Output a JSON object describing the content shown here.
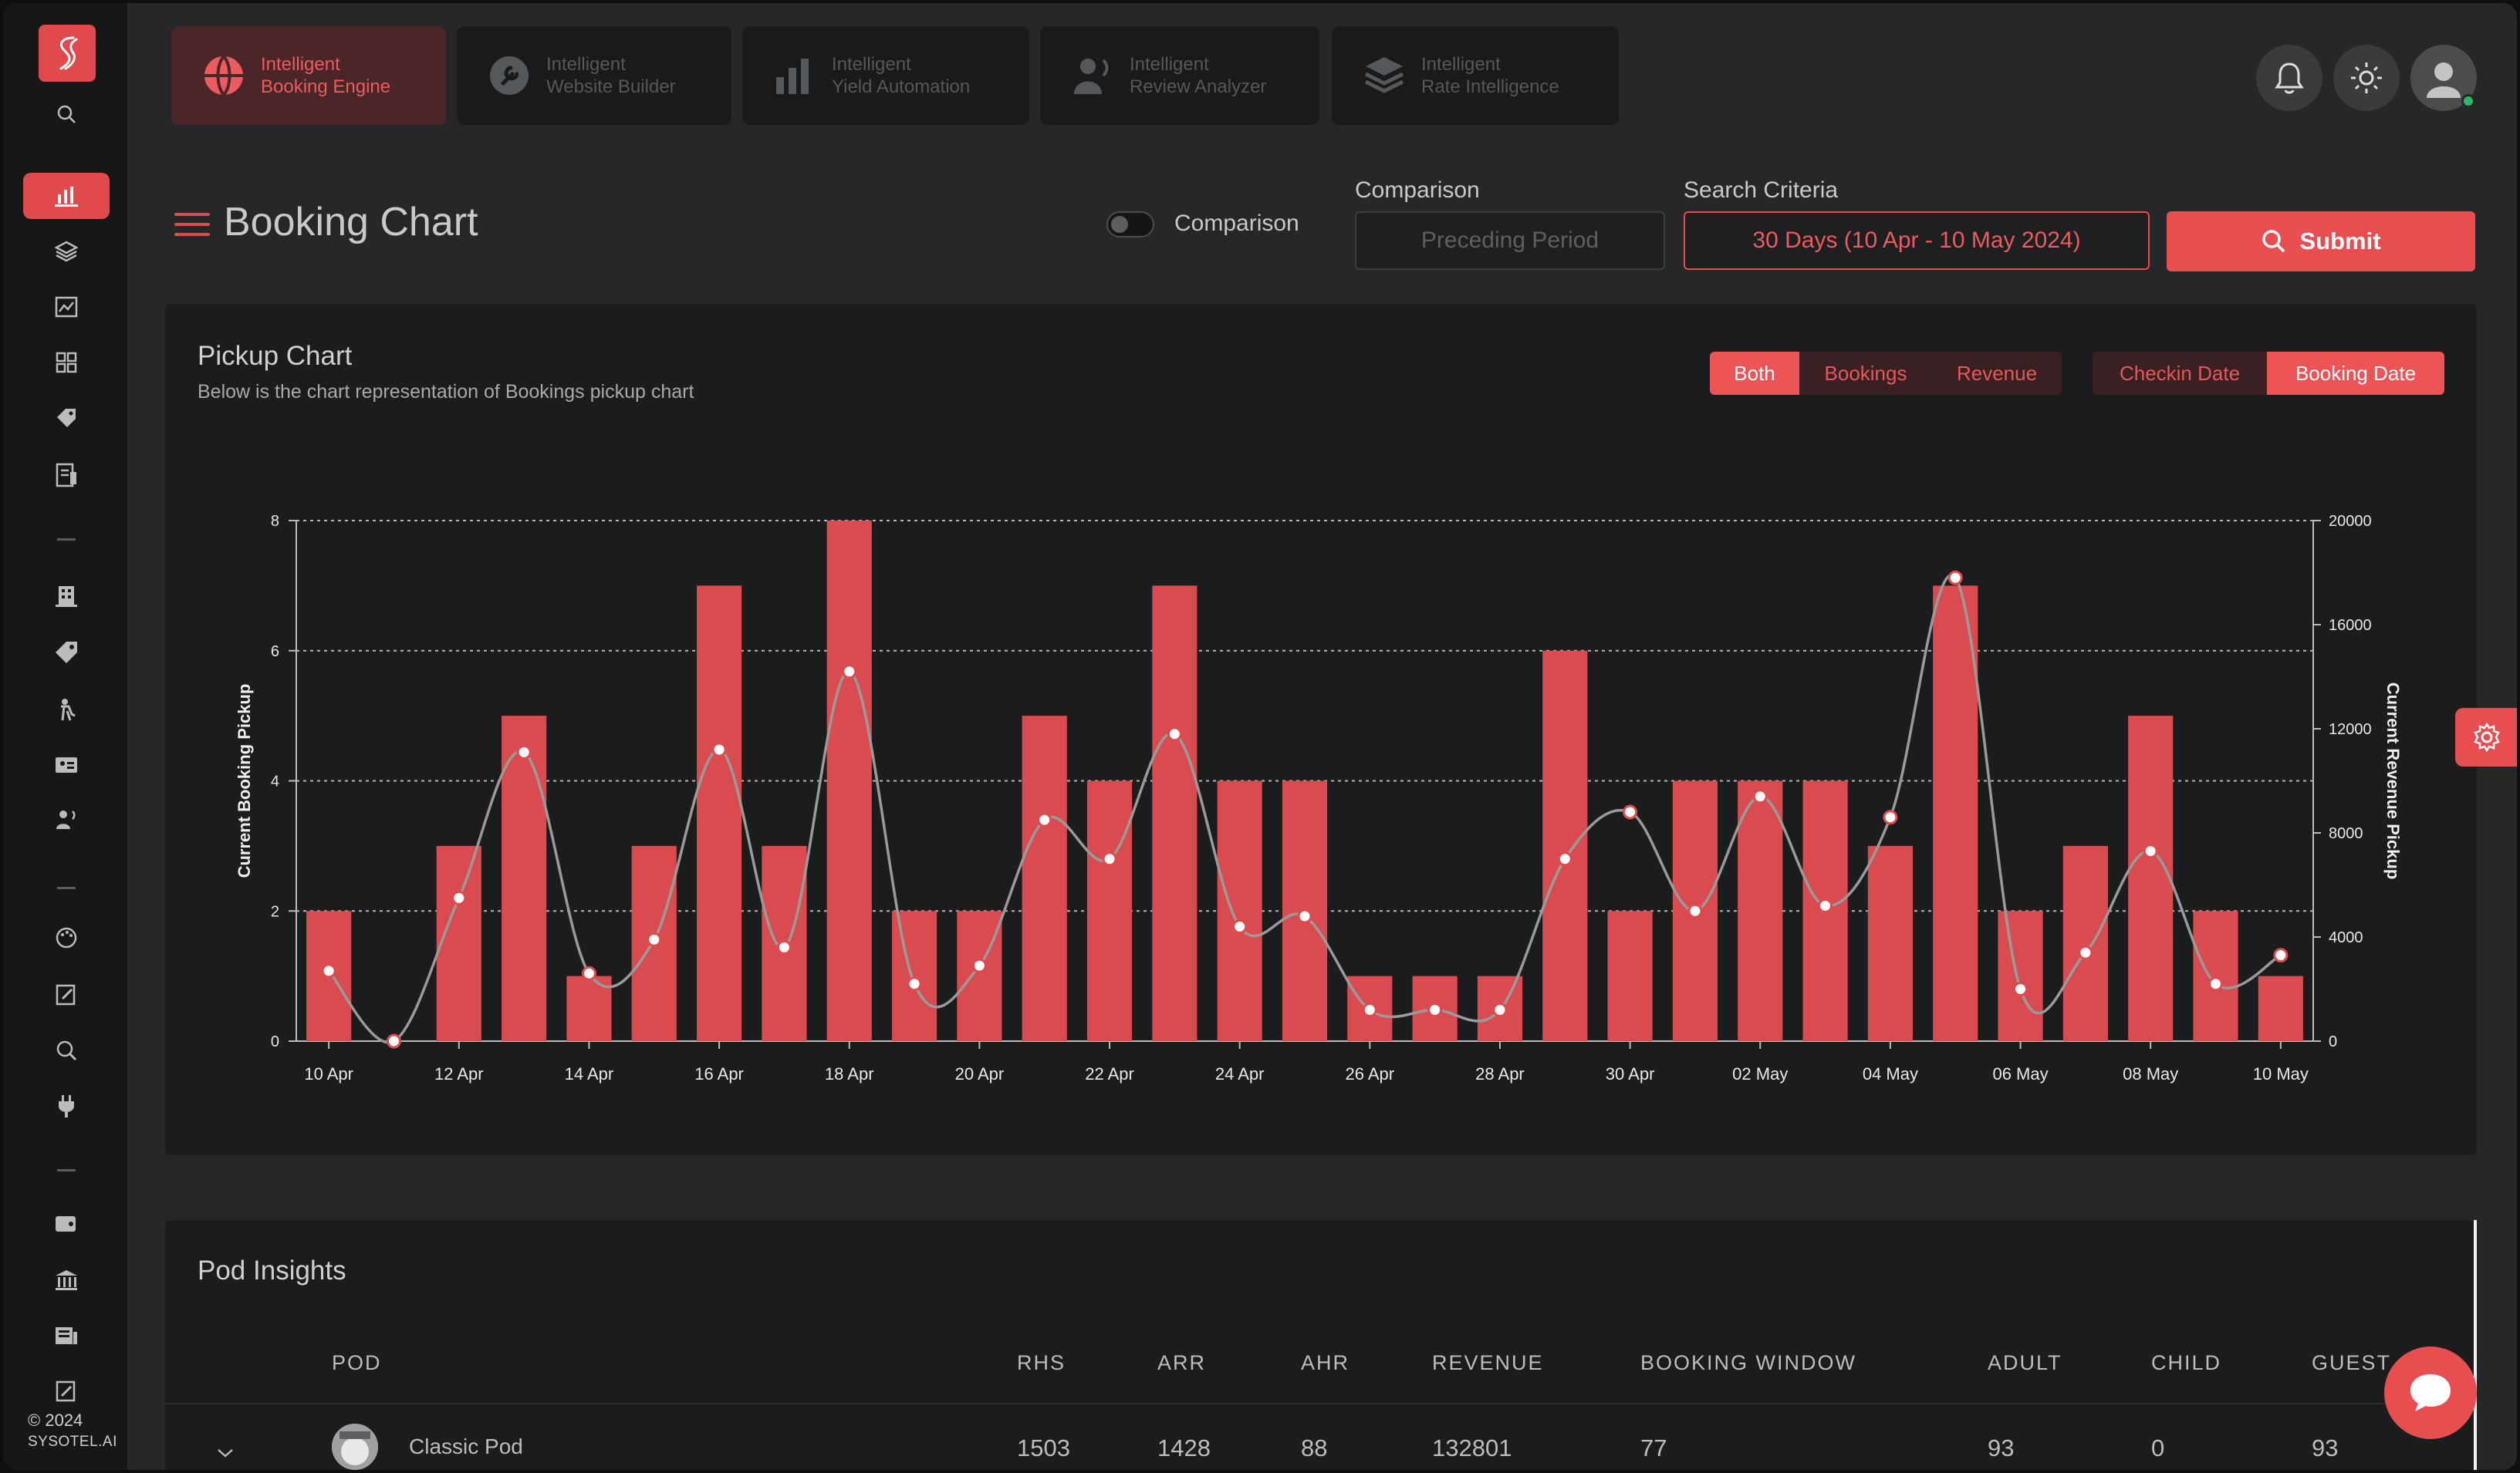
{
  "sidebar": {
    "logo_icon": "sysotel-logo-icon",
    "icons": [
      "search-icon",
      "bar-chart-icon",
      "layers-icon",
      "image-chart-icon",
      "grid-icon",
      "tag-icon",
      "document-icon",
      "building-icon",
      "price-tag-icon",
      "person-icon",
      "id-card-icon",
      "broadcast-icon",
      "palette-icon",
      "edit-note-icon",
      "search-chat-icon",
      "plug-icon",
      "wallet-icon",
      "bank-icon",
      "news-icon",
      "edit-icon"
    ],
    "copyright_year": "2024",
    "brand": "SYSOTEL.AI"
  },
  "product_tabs": [
    {
      "line1": "Intelligent",
      "line2": "Booking Engine",
      "icon": "globe-icon",
      "active": true
    },
    {
      "line1": "Intelligent",
      "line2": "Website Builder",
      "icon": "wrench-icon",
      "active": false
    },
    {
      "line1": "Intelligent",
      "line2": "Yield Automation",
      "icon": "bars-icon",
      "active": false
    },
    {
      "line1": "Intelligent",
      "line2": "Review Analyzer",
      "icon": "speaker-person-icon",
      "active": false
    },
    {
      "line1": "Intelligent",
      "line2": "Rate Intelligence",
      "icon": "stack-icon",
      "active": false
    }
  ],
  "header": {
    "title": "Booking Chart",
    "comparison_toggle_label": "Comparison",
    "comparison_field_label": "Comparison",
    "comparison_placeholder": "Preceding Period",
    "search_label": "Search Criteria",
    "search_value": "30 Days (10 Apr - 10 May 2024)",
    "submit_label": "Submit"
  },
  "chart_card": {
    "title": "Pickup Chart",
    "subtitle": "Below is the chart representation of Bookings pickup chart",
    "metric_toggle": [
      "Both",
      "Bookings",
      "Revenue"
    ],
    "metric_selected": "Both",
    "date_toggle": [
      "Checkin Date",
      "Booking Date"
    ],
    "date_selected": "Booking Date"
  },
  "chart_data": {
    "type": "bar",
    "categories": [
      "10 Apr",
      "11 Apr",
      "12 Apr",
      "13 Apr",
      "14 Apr",
      "15 Apr",
      "16 Apr",
      "17 Apr",
      "18 Apr",
      "19 Apr",
      "20 Apr",
      "21 Apr",
      "22 Apr",
      "23 Apr",
      "24 Apr",
      "25 Apr",
      "26 Apr",
      "27 Apr",
      "28 Apr",
      "29 Apr",
      "30 Apr",
      "01 May",
      "02 May",
      "03 May",
      "04 May",
      "05 May",
      "06 May",
      "07 May",
      "08 May",
      "09 May",
      "10 May"
    ],
    "x_tick_labels": [
      "10 Apr",
      "12 Apr",
      "14 Apr",
      "16 Apr",
      "18 Apr",
      "20 Apr",
      "22 Apr",
      "24 Apr",
      "26 Apr",
      "28 Apr",
      "30 Apr",
      "02 May",
      "04 May",
      "06 May",
      "08 May",
      "10 May"
    ],
    "series": [
      {
        "axis": "left",
        "type": "bar",
        "color": "#d94b4e",
        "values": [
          2,
          0,
          3,
          5,
          1,
          3,
          7,
          3,
          8,
          2,
          2,
          5,
          4,
          7,
          4,
          4,
          1,
          1,
          1,
          6,
          2,
          4,
          4,
          4,
          3,
          7,
          2,
          3,
          5,
          2,
          1
        ]
      },
      {
        "axis": "right",
        "type": "line",
        "color": "#9a9a9a",
        "values": [
          2700,
          0,
          5500,
          11100,
          2600,
          3900,
          11200,
          3600,
          14200,
          2200,
          2900,
          8500,
          7000,
          11800,
          4400,
          4800,
          1200,
          1200,
          1200,
          7000,
          8800,
          5000,
          9400,
          5200,
          8600,
          17800,
          2000,
          3400,
          7300,
          2200,
          3300
        ]
      }
    ],
    "ylabel_left": "Current Booking Pickup",
    "ylabel_right": "Current Revenue Pickup",
    "ylim_left": [
      0,
      8
    ],
    "yticks_left": [
      "0",
      "2",
      "4",
      "6",
      "8"
    ],
    "ylim_right": [
      0,
      20000
    ],
    "yticks_right": [
      "0",
      "4000",
      "8000",
      "12000",
      "16000",
      "20000"
    ],
    "grid": true
  },
  "pod": {
    "title": "Pod Insights",
    "columns": [
      "POD",
      "RHS",
      "ARR",
      "AHR",
      "REVENUE",
      "BOOKING WINDOW",
      "ADULT",
      "CHILD",
      "GUEST"
    ],
    "rows": [
      {
        "name": "Classic Pod",
        "rhs": "1503",
        "arr": "1428",
        "ahr": "88",
        "revenue": "132801",
        "booking_window": "77",
        "adult": "93",
        "child": "0",
        "guest": "93"
      }
    ]
  },
  "colors": {
    "accent": "#e84e50",
    "background": "#252728",
    "card": "#1a1c1d"
  }
}
